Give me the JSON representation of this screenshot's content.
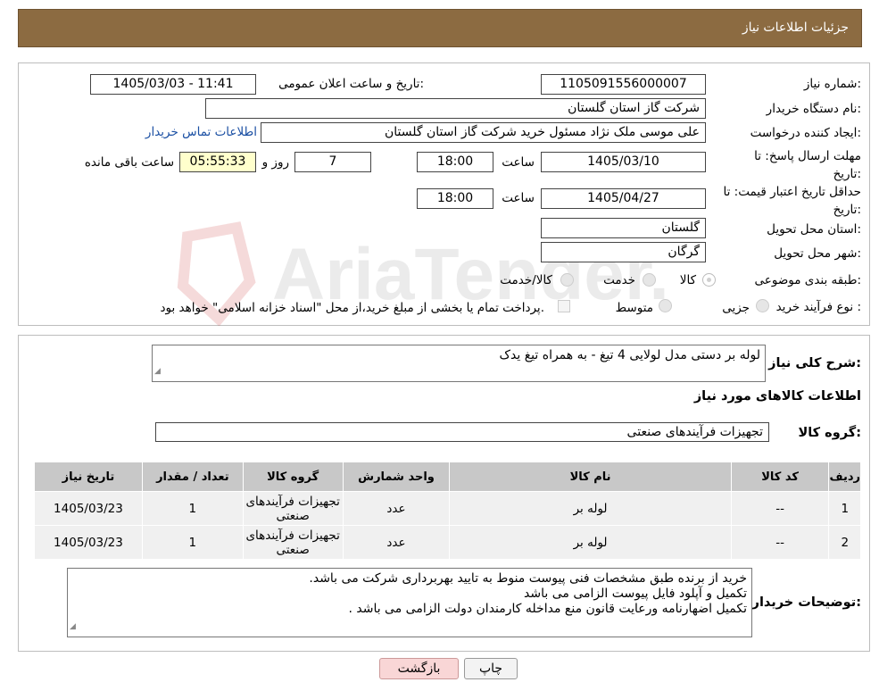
{
  "header": {
    "title": "جزئیات اطلاعات نیاز"
  },
  "form": {
    "need_number_label": "شماره نیاز:",
    "need_number": "1105091556000007",
    "announce_label": "تاریخ و ساعت اعلان عمومی:",
    "announce_value": "1405/03/03 - 11:41",
    "buyer_label": "نام دستگاه خریدار:",
    "buyer_value": "شرکت گاز استان گلستان",
    "creator_label": "ایجاد کننده درخواست:",
    "creator_value": "علی موسی ملک نژاد مسئول خرید شرکت گاز استان گلستان",
    "contact_link": "اطلاعات تماس خریدار",
    "deadline_label": "مهلت ارسال پاسخ: تا تاریخ:",
    "deadline_date": "1405/03/10",
    "time_word": "ساعت",
    "deadline_time": "18:00",
    "days_value": "7",
    "days_word": "روز و",
    "remaining_time": "05:55:33",
    "remaining_word": "ساعت باقی مانده",
    "validity_label": "حداقل تاریخ اعتبار قیمت: تا تاریخ:",
    "validity_date": "1405/04/27",
    "validity_time": "18:00",
    "province_label": "استان محل تحویل:",
    "province_value": "گلستان",
    "city_label": "شهر محل تحویل:",
    "city_value": "گرگان",
    "category_label": "طبقه بندی موضوعی:",
    "cat_goods": "کالا",
    "cat_service": "خدمت",
    "cat_both": "کالا/خدمت",
    "process_label": "نوع فرآیند خرید :",
    "proc_minor": "جزیی",
    "proc_medium": "متوسط",
    "payment_note": "پرداخت تمام یا بخشی از مبلغ خرید،از محل \"اسناد خزانه اسلامی\" خواهد بود."
  },
  "summary": {
    "label": "شرح کلی نیاز:",
    "value": "لوله بر دستی مدل لولایی 4 تیغ - به همراه  تیغ یدک"
  },
  "goods": {
    "section_title": "اطلاعات کالاهای مورد نیاز",
    "group_label": "گروه کالا:",
    "group_value": "تجهیزات فرآیندهای صنعتی",
    "headers": [
      "ردیف",
      "کد کالا",
      "نام کالا",
      "واحد شمارش",
      "گروه کالا",
      "تعداد / مقدار",
      "تاریخ نیاز"
    ],
    "rows": [
      [
        "1",
        "--",
        "لوله بر",
        "عدد",
        "تجهیزات فرآیندهای صنعتی",
        "1",
        "1405/03/23"
      ],
      [
        "2",
        "--",
        "لوله بر",
        "عدد",
        "تجهیزات فرآیندهای صنعتی",
        "1",
        "1405/03/23"
      ]
    ]
  },
  "notes": {
    "label": "توضیحات خریدار:",
    "lines": [
      "خرید از برنده طبق مشخصات فنی پیوست منوط به تایید بهربرداری شرکت می باشد.",
      "تکمیل و آپلود فایل پیوست الزامی می باشد",
      "تکمیل اضهارنامه ورعایت قانون منع مداخله کارمندان دولت الزامی می باشد ."
    ]
  },
  "buttons": {
    "print": "چاپ",
    "back": "بازگشت"
  },
  "watermark": {
    "text": "AriaTender.neT"
  },
  "colors": {
    "header_bg": "#8c6b41",
    "time_bg": "#ffffcc",
    "link": "#1a4fa3"
  }
}
